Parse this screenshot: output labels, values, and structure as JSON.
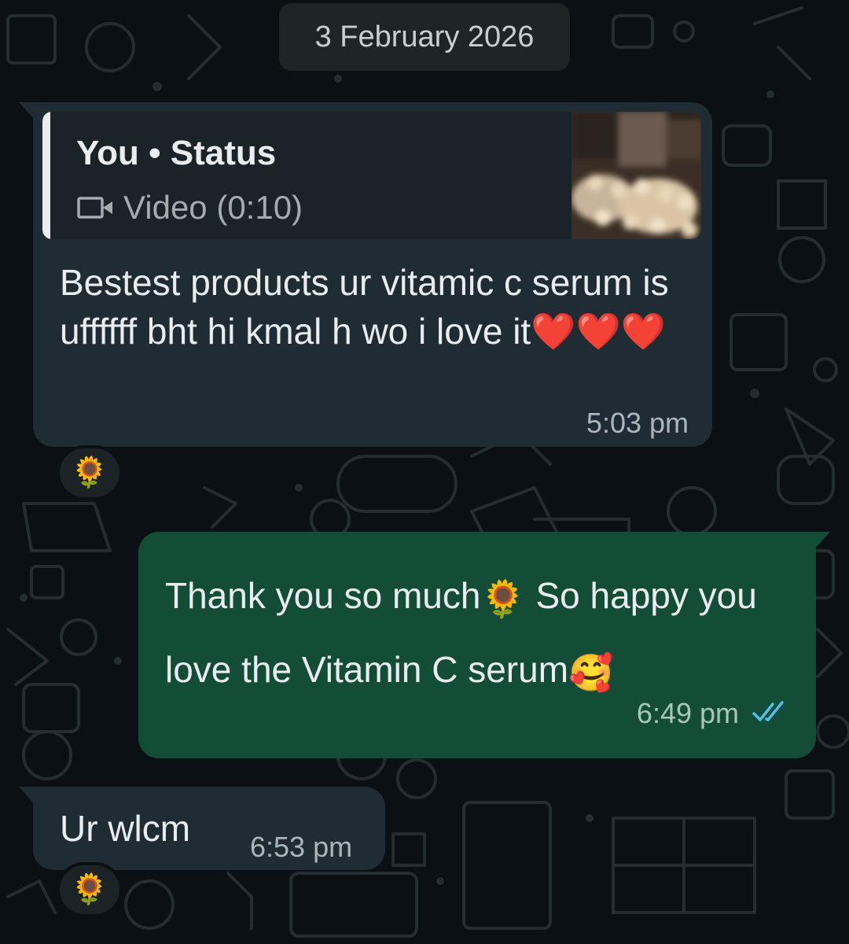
{
  "date_divider": "3 February 2026",
  "messages": [
    {
      "direction": "incoming",
      "reply_to": {
        "author": "You",
        "separator": "•",
        "source": "Status",
        "media_label": "Video (0:10)"
      },
      "text": "Bestest products ur vitamic c serum is uffffff bht hi kmal h wo i love it",
      "emojis": [
        "❤️",
        "❤️",
        "❤️"
      ],
      "time": "5:03 pm",
      "reaction": "🌻"
    },
    {
      "direction": "outgoing",
      "text_part1": "Thank you so much",
      "text_part2": " So happy you love the Vitamin C serum",
      "emoji1": "🌻",
      "emoji2": "🥰",
      "time": "6:49 pm",
      "status": "read"
    },
    {
      "direction": "incoming",
      "text": "Ur wlcm",
      "time": "6:53 pm",
      "reaction": "🌻"
    }
  ],
  "colors": {
    "background": "#0b1014",
    "incoming_bubble": "#202c33",
    "outgoing_bubble": "#144d37",
    "read_ticks": "#53bdeb"
  }
}
